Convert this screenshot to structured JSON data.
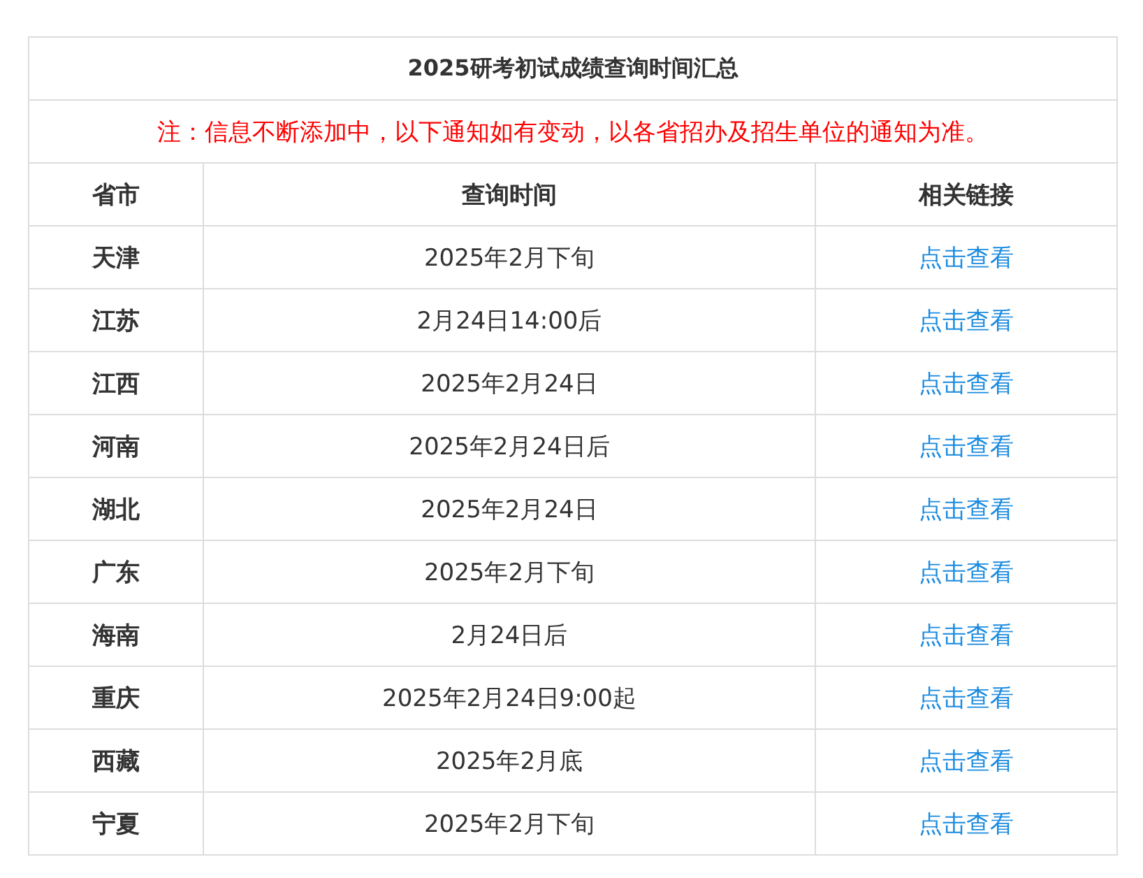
{
  "table": {
    "title": "2025研考初试成绩查询时间汇总",
    "note": "注：信息不断添加中，以下通知如有变动，以各省招办及招生单位的通知为准。",
    "columns": [
      "省市",
      "查询时间",
      "相关链接"
    ],
    "rows": [
      {
        "province": "天津",
        "time": "2025年2月下旬",
        "link": "点击查看"
      },
      {
        "province": "江苏",
        "time": "2月24日14:00后",
        "link": "点击查看"
      },
      {
        "province": "江西",
        "time": "2025年2月24日",
        "link": "点击查看"
      },
      {
        "province": "河南",
        "time": "2025年2月24日后",
        "link": "点击查看"
      },
      {
        "province": "湖北",
        "time": "2025年2月24日",
        "link": "点击查看"
      },
      {
        "province": "广东",
        "time": "2025年2月下旬",
        "link": "点击查看"
      },
      {
        "province": "海南",
        "time": "2月24日后",
        "link": "点击查看"
      },
      {
        "province": "重庆",
        "time": "2025年2月24日9:00起",
        "link": "点击查看"
      },
      {
        "province": "西藏",
        "time": "2025年2月底",
        "link": "点击查看"
      },
      {
        "province": "宁夏",
        "time": "2025年2月下旬",
        "link": "点击查看"
      }
    ]
  }
}
